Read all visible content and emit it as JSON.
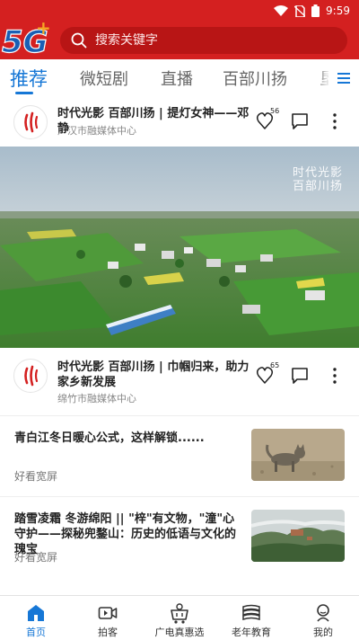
{
  "status_bar": {
    "time": "9:59"
  },
  "header": {
    "logo_text": "5G+",
    "search_placeholder": "搜索关键字"
  },
  "tabs": [
    {
      "label": "推荐",
      "active": true
    },
    {
      "label": "微短剧",
      "active": false
    },
    {
      "label": "直播",
      "active": false
    },
    {
      "label": "百部川扬",
      "active": false
    },
    {
      "label": "垦",
      "active": false
    }
  ],
  "feed": {
    "video_posts": [
      {
        "title": "时代光影 百部川扬 | 提灯女神——邓静",
        "source": "广汉市融媒体中心",
        "likes": "56",
        "watermark_line1": "时代光影",
        "watermark_line2": "百部川扬"
      },
      {
        "title": "时代光影 百部川扬 | 巾帼归来，助力家乡新发展",
        "source": "绵竹市融媒体中心",
        "likes": "65"
      }
    ],
    "articles": [
      {
        "title": "青白江冬日暖心公式，这样解锁......",
        "source": "好看宽屏"
      },
      {
        "title": "踏雪凌霜 冬游绵阳 || \"梓\"有文物，\"潼\"心守护——探秘兜鍪山：历史的低语与文化的瑰宝",
        "source": "好看宽屏"
      }
    ]
  },
  "bottom_nav": [
    {
      "label": "首页",
      "icon": "home-icon",
      "active": true
    },
    {
      "label": "拍客",
      "icon": "video-camera-icon",
      "active": false
    },
    {
      "label": "广电真惠选",
      "icon": "shopping-cart-icon",
      "active": false
    },
    {
      "label": "老年教育",
      "icon": "book-stack-icon",
      "active": false
    },
    {
      "label": "我的",
      "icon": "person-icon",
      "active": false
    }
  ],
  "colors": {
    "brand_red": "#d42020",
    "accent_blue": "#1677d6"
  }
}
